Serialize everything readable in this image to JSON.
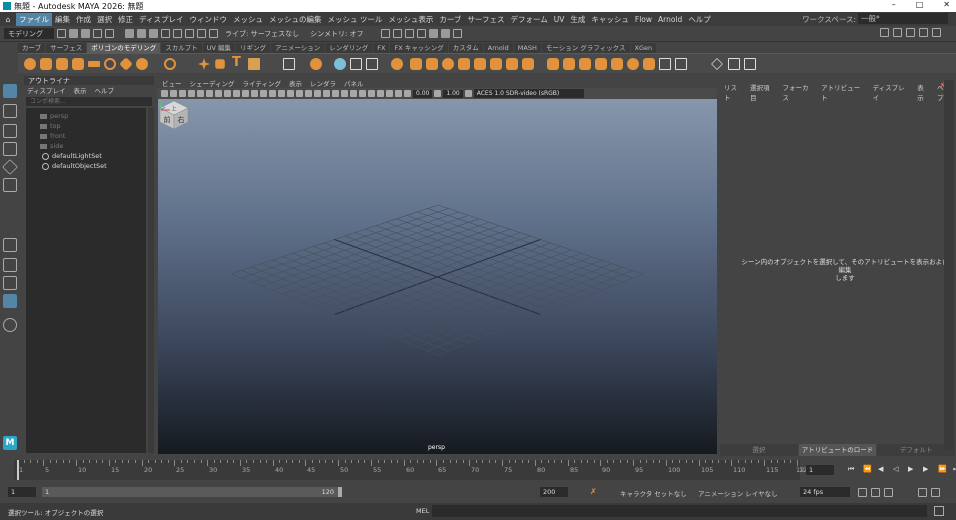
{
  "window": {
    "title": "無題 - Autodesk MAYA 2026: 無題",
    "controls": [
      "–",
      "□",
      "✕"
    ]
  },
  "menubar": {
    "items": [
      "ファイル",
      "編集",
      "作成",
      "選択",
      "修正",
      "ディスプレイ",
      "ウィンドウ",
      "メッシュ",
      "メッシュの編集",
      "メッシュ ツール",
      "メッシュ表示",
      "カーブ",
      "サーフェス",
      "デフォーム",
      "UV",
      "生成",
      "キャッシュ",
      "Flow",
      "Arnold",
      "ヘルプ"
    ],
    "workspace_label": "ワークスペース:",
    "workspace_value": "一般*"
  },
  "statusline": {
    "mode": "モデリング",
    "live_surface": "ライブ: サーフェスなし",
    "symmetry": "シンメトリ: オフ"
  },
  "shelf_tabs": [
    "カーブ",
    "サーフェス",
    "ポリゴンのモデリング",
    "スカルプト",
    "UV 編集",
    "リギング",
    "アニメーション",
    "レンダリング",
    "FX",
    "FX キャッシング",
    "カスタム",
    "Arnold",
    "MASH",
    "モーション グラフィックス",
    "XGen"
  ],
  "outliner": {
    "title": "アウトライナ",
    "menus": [
      "ディスプレイ",
      "表示",
      "ヘルプ"
    ],
    "search_placeholder": "コンポ検索...",
    "items": [
      {
        "label": "persp",
        "kind": "camera",
        "dim": true
      },
      {
        "label": "top",
        "kind": "camera",
        "dim": true
      },
      {
        "label": "front",
        "kind": "camera",
        "dim": true
      },
      {
        "label": "side",
        "kind": "camera",
        "dim": true
      },
      {
        "label": "defaultLightSet",
        "kind": "set",
        "dim": false
      },
      {
        "label": "defaultObjectSet",
        "kind": "set",
        "dim": false
      }
    ]
  },
  "viewport": {
    "menus": [
      "ビュー",
      "シェーディング",
      "ライティング",
      "表示",
      "レンダラ",
      "パネル"
    ],
    "exposure": "0.00",
    "gamma": "1.00",
    "colorspace": "ACES 1.0 SDR-video (sRGB)",
    "camera_label": "persp",
    "viewcube": {
      "front": "前",
      "right": "右",
      "top": "上"
    }
  },
  "attribute_panel": {
    "tabs": [
      "リスト",
      "選択項目",
      "フォーカス",
      "アトリビュート",
      "ディスプレイ",
      "表示",
      "ヘルプ"
    ],
    "message_line1": "シーン内のオブジェクトを選択して、そのアトリビュートを表示および編集",
    "message_line2": "します",
    "bottom_tabs": [
      "選択",
      "アトリビュートのロード",
      "デフォルト"
    ]
  },
  "timeslider": {
    "ticks": [
      "1",
      "5",
      "10",
      "15",
      "20",
      "25",
      "30",
      "35",
      "40",
      "45",
      "50",
      "55",
      "60",
      "65",
      "70",
      "75",
      "80",
      "85",
      "90",
      "95",
      "100",
      "105",
      "110",
      "115",
      "120"
    ],
    "trailing": "12",
    "current_frame": "1"
  },
  "range": {
    "start": "1",
    "inner_start": "1",
    "inner_end": "120",
    "end": "200",
    "character_set": "キャラクタ セットなし",
    "anim_layer": "アニメーション レイヤなし",
    "fps": "24 fps"
  },
  "commandline": {
    "help_text": "選択ツール: オブジェクトの選択",
    "mel_label": "MEL"
  },
  "colors": {
    "accent": "#5285a6",
    "shelf_orange": "#e0923c"
  }
}
